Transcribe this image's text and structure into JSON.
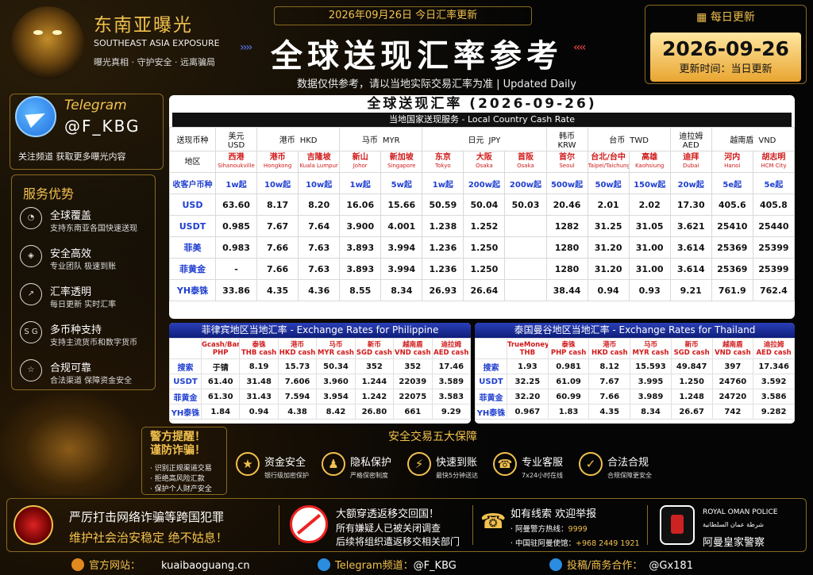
{
  "brand": {
    "cn": "东南亚曝光",
    "en": "SOUTHEAST ASIA EXPOSURE",
    "sub": "曝光真相 · 守护安全 · 远离骗局"
  },
  "header": {
    "date_line": "2026年09月26日  今日汇率更新",
    "title": "全球送现汇率参考",
    "subtitle": "数据仅供参考，请以当地实际交易汇率为准 | Updated Daily",
    "arrows_left": "››››",
    "arrows_right": "‹‹‹‹"
  },
  "update": {
    "label": "每日更新",
    "date": "2026-09-26",
    "time": "更新时间：当日更新"
  },
  "telegram": {
    "name": "Telegram",
    "handle": "@F_KBG",
    "desc": "关注频道  获取更多曝光内容"
  },
  "services": {
    "title": "服务优势",
    "items": [
      {
        "icon": "globe",
        "title": "全球覆盖",
        "desc": "支持东南亚各国快速送现"
      },
      {
        "icon": "shield",
        "title": "安全高效",
        "desc": "专业团队 极速到账"
      },
      {
        "icon": "chart",
        "title": "汇率透明",
        "desc": "每日更新 实时汇率"
      },
      {
        "icon": "coins",
        "title": "多币种支持",
        "desc": "支持主流货币和数字货币"
      },
      {
        "icon": "star",
        "title": "合规可靠",
        "desc": "合法渠道 保障资金安全"
      }
    ]
  },
  "rate": {
    "title": "全球送现汇率 (2026-09-26)",
    "sub": "当地国家送现服务 - Local Country Cash Rate",
    "currency_label": "送现币种",
    "region_label": "地区",
    "recv_label": "收客户币种",
    "currencies": [
      {
        "cn": "美元",
        "en": "USD",
        "span": 1
      },
      {
        "cn": "港币",
        "en": "HKD",
        "span": 2
      },
      {
        "cn": "马币",
        "en": "MYR",
        "span": 2
      },
      {
        "cn": "日元",
        "en": "JPY",
        "span": 3
      },
      {
        "cn": "韩币",
        "en": "KRW",
        "span": 1
      },
      {
        "cn": "台币",
        "en": "TWD",
        "span": 2
      },
      {
        "cn": "迪拉姆",
        "en": "AED",
        "span": 1
      },
      {
        "cn": "越南盾",
        "en": "VND",
        "span": 2
      }
    ],
    "regions": [
      [
        "西港",
        "Sihanoukville"
      ],
      [
        "港币",
        "Hongkong"
      ],
      [
        "吉隆坡",
        "Kuala Lumpur"
      ],
      [
        "新山",
        "Johor"
      ],
      [
        "新加坡",
        "Singapore"
      ],
      [
        "东京",
        "Tokyo"
      ],
      [
        "大阪",
        "Osaka"
      ],
      [
        "首阪",
        "Osaka"
      ],
      [
        "首尔",
        "Seoul"
      ],
      [
        "台北/台中",
        "Taipei/Taichung"
      ],
      [
        "高雄",
        "Kaohsiung"
      ],
      [
        "迪拜",
        "Dubai"
      ],
      [
        "河内",
        "Hanoi"
      ],
      [
        "胡志明",
        "HCM City"
      ]
    ],
    "recv": [
      "1w起",
      "10w起",
      "10w起",
      "1w起",
      "5w起",
      "1w起",
      "200w起",
      "200w起",
      "500w起",
      "50w起",
      "150w起",
      "20w起",
      "5e起",
      "5e起"
    ],
    "rows": [
      {
        "label": "USD",
        "vals": [
          "63.60",
          "8.17",
          "8.20",
          "16.06",
          "15.66",
          "50.59",
          "50.04",
          "50.03",
          "20.46",
          "2.01",
          "2.02",
          "17.30",
          "405.6",
          "405.8"
        ]
      },
      {
        "label": "USDT",
        "vals": [
          "0.985",
          "7.67",
          "7.64",
          "3.900",
          "4.001",
          "1.238",
          "1.252",
          "",
          "1282",
          "31.25",
          "31.05",
          "3.621",
          "25410",
          "25440"
        ]
      },
      {
        "label": "菲美",
        "vals": [
          "0.983",
          "7.66",
          "7.63",
          "3.893",
          "3.994",
          "1.236",
          "1.250",
          "",
          "1280",
          "31.20",
          "31.00",
          "3.614",
          "25369",
          "25399"
        ]
      },
      {
        "label": "菲黄金",
        "vals": [
          "-",
          "7.66",
          "7.63",
          "3.893",
          "3.994",
          "1.236",
          "1.250",
          "",
          "1280",
          "31.20",
          "31.00",
          "3.614",
          "25369",
          "25399"
        ]
      },
      {
        "label": "YH泰铢",
        "vals": [
          "33.86",
          "4.35",
          "4.36",
          "8.55",
          "8.34",
          "26.93",
          "26.64",
          "",
          "38.44",
          "0.94",
          "0.93",
          "9.21",
          "761.9",
          "762.4"
        ]
      }
    ]
  },
  "ph": {
    "title": "菲律宾地区当地汇率 - Exchange Rates for Philippine",
    "headers": [
      [
        "Gcash/Bank",
        "PHP"
      ],
      [
        "泰铢",
        "THB cash"
      ],
      [
        "港币",
        "HKD cash"
      ],
      [
        "马币",
        "MYR cash"
      ],
      [
        "新币",
        "SGD cash"
      ],
      [
        "越南盾",
        "VND cash"
      ],
      [
        "迪拉姆",
        "AED cash"
      ]
    ],
    "rows": [
      {
        "label": "搜索",
        "vals": [
          "于锖",
          "8.19",
          "15.73",
          "50.34",
          "352",
          "352",
          "17.46"
        ]
      },
      {
        "label": "USDT",
        "vals": [
          "61.40",
          "31.48",
          "7.606",
          "3.960",
          "1.244",
          "22039",
          "3.589"
        ]
      },
      {
        "label": "菲黄金",
        "vals": [
          "61.30",
          "31.43",
          "7.594",
          "3.954",
          "1.242",
          "22075",
          "3.583"
        ]
      },
      {
        "label": "YH泰铢",
        "vals": [
          "1.84",
          "0.94",
          "4.38",
          "8.42",
          "26.80",
          "661",
          "9.29"
        ]
      }
    ]
  },
  "th": {
    "title": "泰国曼谷地区当地汇率 - Exchange Rates for Thailand",
    "headers": [
      [
        "TrueMoney",
        "THB"
      ],
      [
        "泰铢",
        "PHP cash"
      ],
      [
        "港币",
        "HKD cash"
      ],
      [
        "马币",
        "MYR cash"
      ],
      [
        "新币",
        "SGD cash"
      ],
      [
        "越南盾",
        "VND cash"
      ],
      [
        "迪拉姆",
        "AED cash"
      ]
    ],
    "rows": [
      {
        "label": "搜索",
        "vals": [
          "1.93",
          "0.981",
          "8.12",
          "15.593",
          "49.847",
          "397",
          "17.346"
        ]
      },
      {
        "label": "USDT",
        "vals": [
          "32.25",
          "61.09",
          "7.67",
          "3.995",
          "1.250",
          "24760",
          "3.592"
        ]
      },
      {
        "label": "菲黄金",
        "vals": [
          "32.20",
          "60.99",
          "7.66",
          "3.989",
          "1.248",
          "24720",
          "3.586"
        ]
      },
      {
        "label": "YH泰铢",
        "vals": [
          "0.967",
          "1.83",
          "4.35",
          "8.34",
          "26.67",
          "742",
          "9.282"
        ]
      }
    ]
  },
  "warning": {
    "l1": "警方提醒！",
    "l2": "谨防诈骗！",
    "items": [
      "· 识别正规渠道交易",
      "· 拒绝高风险汇款",
      "· 保护个人财产安全"
    ]
  },
  "guarantee": {
    "title": "安全交易五大保障",
    "items": [
      {
        "icon": "★",
        "title": "资金安全",
        "desc": "银行级加密保护"
      },
      {
        "icon": "♟",
        "title": "隐私保护",
        "desc": "严格保密制度"
      },
      {
        "icon": "⚡",
        "title": "快速到账",
        "desc": "最快5分钟送达"
      },
      {
        "icon": "☎",
        "title": "专业客服",
        "desc": "7x24小时在线"
      },
      {
        "icon": "✓",
        "title": "合法合规",
        "desc": "合规保障更安全"
      }
    ]
  },
  "banner": {
    "s1a": "严厉打击网络诈骗等跨国犯罪",
    "s1b": "维护社会治安稳定  绝不姑息！",
    "s2a": "大额穿透返移交回国！",
    "s2b": "所有嫌疑人已被关闭调查",
    "s2c": "后续将组织遣返移交相关部门",
    "s3a": "如有线索  欢迎举报",
    "s3b": "· 阿曼警方热线：",
    "s3b_v": "9999",
    "s3c": "· 中国驻阿曼使馆：",
    "s3c_v": "+968 2449 1921",
    "s4a": "ROYAL OMAN POLICE",
    "s4b": "شرطة عمان السلطانية",
    "s4c": "阿曼皇家警察"
  },
  "footer": {
    "web_label": "官方网站：",
    "web": "kuaibaoguang.cn",
    "tg_label": "Telegram频道：",
    "tg": "@F_KBG",
    "contact_label": "投稿/商务合作：",
    "contact": "@Gx181"
  },
  "colors": {
    "gold": "#f2c14e",
    "blue": "#1f3fd0",
    "red": "#d01919"
  }
}
